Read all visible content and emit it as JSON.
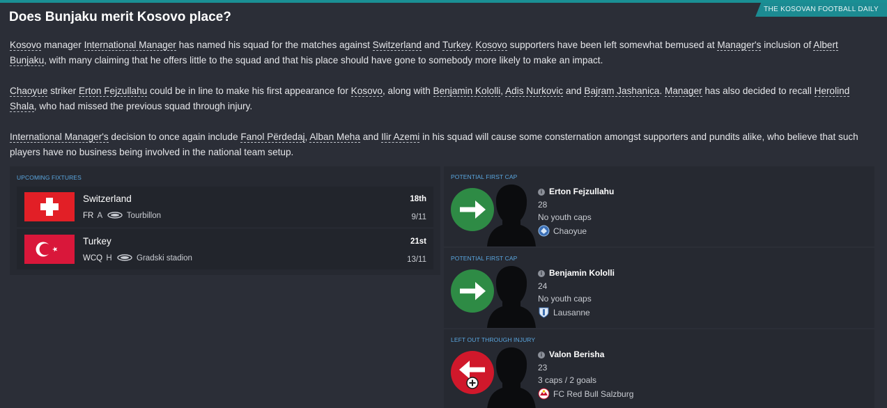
{
  "source": "THE KOSOVAN FOOTBALL DAILY",
  "headline": "Does Bunjaku merit Kosovo place?",
  "paragraphs": [
    [
      {
        "t": "Kosovo",
        "link": true
      },
      {
        "t": " manager "
      },
      {
        "t": "International Manager",
        "link": true
      },
      {
        "t": " has named his squad for the matches against "
      },
      {
        "t": "Switzerland",
        "link": true
      },
      {
        "t": " and "
      },
      {
        "t": "Turkey",
        "link": true
      },
      {
        "t": ". "
      },
      {
        "t": "Kosovo",
        "link": true
      },
      {
        "t": " supporters have been left somewhat bemused at "
      },
      {
        "t": "Manager's",
        "link": true
      },
      {
        "t": " inclusion of "
      },
      {
        "t": "Albert Bunjaku",
        "link": true
      },
      {
        "t": ", with many claiming that he offers little to the squad and that his place should have gone to somebody more likely to make an impact."
      }
    ],
    [
      {
        "t": "Chaoyue",
        "link": true
      },
      {
        "t": " striker "
      },
      {
        "t": "Erton Fejzullahu",
        "link": true
      },
      {
        "t": " could be in line to make his first appearance for "
      },
      {
        "t": "Kosovo",
        "link": true
      },
      {
        "t": ", along with "
      },
      {
        "t": "Benjamin Kololli",
        "link": true
      },
      {
        "t": ", "
      },
      {
        "t": "Adis Nurkovic",
        "link": true
      },
      {
        "t": " and "
      },
      {
        "t": "Bajram Jashanica",
        "link": true
      },
      {
        "t": ". "
      },
      {
        "t": "Manager",
        "link": true
      },
      {
        "t": " has also decided to recall "
      },
      {
        "t": "Herolind Shala",
        "link": true
      },
      {
        "t": ", who had missed the previous squad through injury."
      }
    ],
    [
      {
        "t": "International Manager's",
        "link": true
      },
      {
        "t": " decision to once again include "
      },
      {
        "t": "Fanol Përdedaj",
        "link": true
      },
      {
        "t": ", "
      },
      {
        "t": "Alban Meha",
        "link": true
      },
      {
        "t": " and "
      },
      {
        "t": "Ilir Azemi",
        "link": true
      },
      {
        "t": " in his squad will cause some consternation amongst supporters and pundits alike, who believe that such players have no business being involved in the national team setup."
      }
    ]
  ],
  "fixtures": {
    "title": "UPCOMING FIXTURES",
    "items": [
      {
        "team": "Switzerland",
        "comp": "FR",
        "venue_type": "A",
        "venue": "Tourbillon",
        "day": "18th",
        "date": "9/11",
        "flag": "switzerland"
      },
      {
        "team": "Turkey",
        "comp": "WCQ",
        "venue_type": "H",
        "venue": "Gradski stadion",
        "day": "21st",
        "date": "13/11",
        "flag": "turkey"
      }
    ]
  },
  "players": [
    {
      "section": "POTENTIAL FIRST CAP",
      "name": "Erton Fejzullahu",
      "age": "28",
      "caps": "No youth caps",
      "club": "Chaoyue",
      "direction": "in",
      "color": "#2e8b45"
    },
    {
      "section": "POTENTIAL FIRST CAP",
      "name": "Benjamin Kololli",
      "age": "24",
      "caps": "No youth caps",
      "club": "Lausanne",
      "direction": "in",
      "color": "#2e8b45"
    },
    {
      "section": "LEFT OUT THROUGH INJURY",
      "name": "Valon Berisha",
      "age": "23",
      "caps": "3 caps / 2 goals",
      "club": "FC Red Bull Salzburg",
      "direction": "out",
      "color": "#d0182b"
    }
  ],
  "colors": {
    "background": "#2b2e37",
    "accent": "#1a8f94",
    "panel_title": "#5aa7e0"
  }
}
